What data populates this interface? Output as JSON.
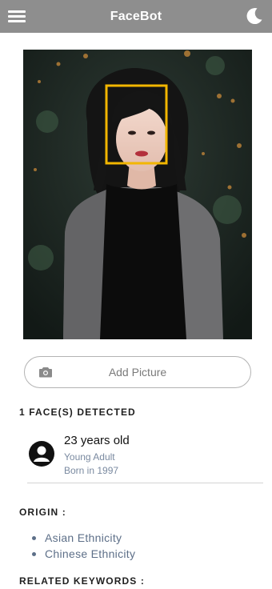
{
  "header": {
    "title": "FaceBot",
    "menu_icon": "hamburger-menu-icon",
    "theme_icon": "moon-icon"
  },
  "photo": {
    "face_box_color": "#f2b600"
  },
  "add_picture": {
    "label": "Add Picture",
    "icon": "camera-icon"
  },
  "detection": {
    "heading": "1 FACE(S) DETECTED",
    "faces": [
      {
        "age": "23 years old",
        "stage": "Young Adult",
        "born": "Born in 1997",
        "icon": "person-avatar-icon"
      }
    ]
  },
  "origin": {
    "heading": "ORIGIN :",
    "items": [
      "Asian Ethnicity",
      "Chinese Ethnicity"
    ]
  },
  "keywords": {
    "heading": "RELATED KEYWORDS :"
  },
  "colors": {
    "header_bg": "#8e8e8e",
    "accent_text": "#5d6f88"
  }
}
